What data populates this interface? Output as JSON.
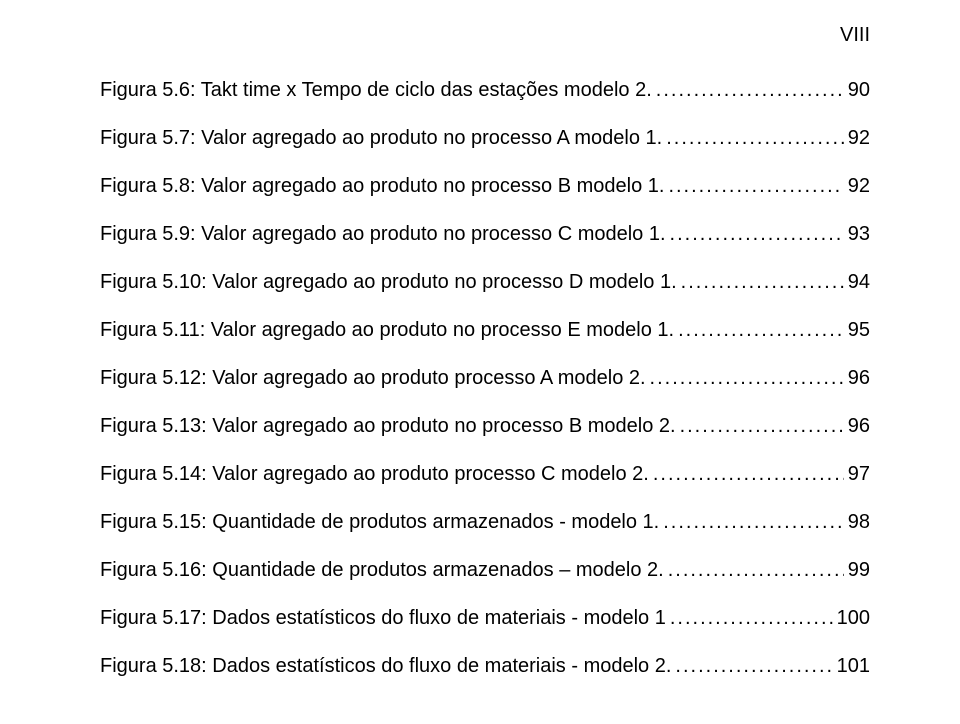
{
  "roman_numeral": "VIII",
  "entries": [
    {
      "text": "Figura 5.6: Takt time x Tempo de ciclo das estações modelo 2.",
      "page": "90"
    },
    {
      "text": "Figura 5.7: Valor agregado ao produto no processo A modelo 1.",
      "page": "92"
    },
    {
      "text": "Figura 5.8: Valor agregado ao produto no processo B modelo 1.",
      "page": "92"
    },
    {
      "text": "Figura 5.9: Valor agregado ao produto no processo C modelo 1.",
      "page": "93"
    },
    {
      "text": "Figura 5.10: Valor agregado ao produto no processo D modelo 1.",
      "page": "94"
    },
    {
      "text": "Figura 5.11: Valor agregado ao produto no processo E modelo 1.",
      "page": "95"
    },
    {
      "text": "Figura 5.12: Valor agregado ao produto processo A modelo 2.",
      "page": "96"
    },
    {
      "text": "Figura 5.13: Valor agregado ao produto no processo B modelo 2.",
      "page": "96"
    },
    {
      "text": "Figura 5.14: Valor agregado ao produto processo C modelo 2.",
      "page": "97"
    },
    {
      "text": "Figura 5.15: Quantidade de produtos armazenados - modelo 1.",
      "page": "98"
    },
    {
      "text": "Figura 5.16: Quantidade de produtos armazenados – modelo 2.",
      "page": "99"
    },
    {
      "text": "Figura 5.17: Dados estatísticos do fluxo de materiais - modelo 1",
      "page": "100"
    },
    {
      "text": "Figura 5.18: Dados estatísticos do fluxo de materiais - modelo 2.",
      "page": "101"
    }
  ]
}
